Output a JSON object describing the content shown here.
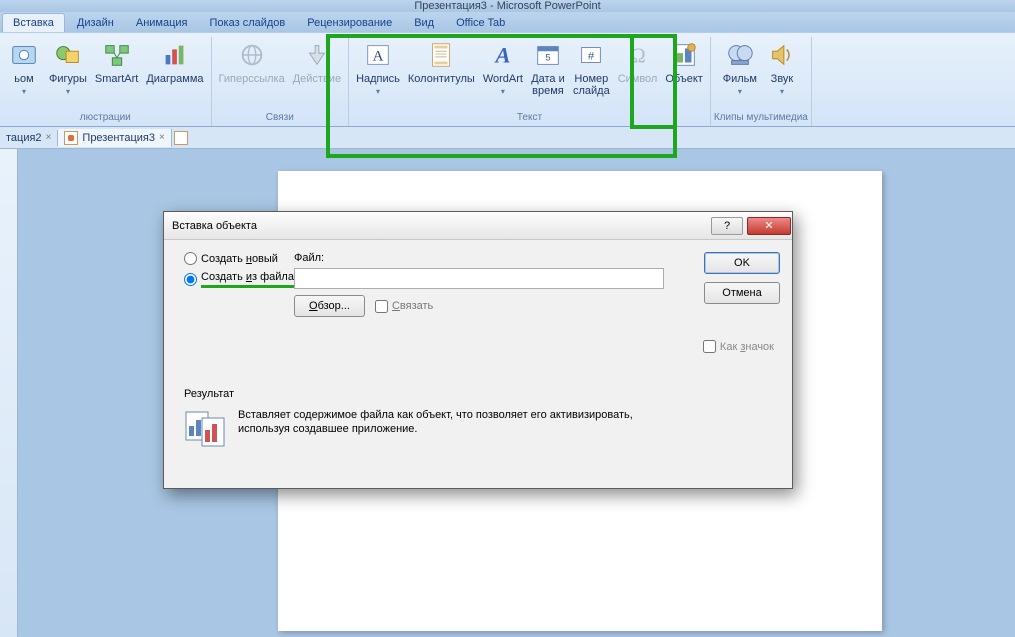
{
  "app_title": "Презентация3 - Microsoft PowerPoint",
  "tabs": {
    "insert": "Вставка",
    "design": "Дизайн",
    "animation": "Анимация",
    "slideshow": "Показ слайдов",
    "review": "Рецензирование",
    "view": "Вид",
    "officetab": "Office Tab"
  },
  "ribbon": {
    "groups": {
      "illustrations": "люстрации",
      "links": "Связи",
      "text": "Текст",
      "media": "Клипы мультимедиа"
    },
    "btns": {
      "album": "ьом",
      "shapes": "Фигуры",
      "smartart": "SmartArt",
      "chart": "Диаграмма",
      "hyperlink": "Гиперссылка",
      "action": "Действие",
      "textbox": "Надпись",
      "headerfooter": "Колонтитулы",
      "wordart": "WordArt",
      "datetime1": "Дата и",
      "datetime2": "время",
      "slidenum1": "Номер",
      "slidenum2": "слайда",
      "symbol": "Символ",
      "object": "Объект",
      "movie": "Фильм",
      "sound": "Звук"
    }
  },
  "doctabs": {
    "tab1": "тация2",
    "tab2": "Презентация3"
  },
  "dialog": {
    "title": "Вставка объекта",
    "create_new": "Создать новый",
    "create_from_file": "Создать из файла",
    "file_label": "Файл:",
    "browse": "Обзор...",
    "link": "Связать",
    "ok": "OK",
    "cancel": "Отмена",
    "as_icon": "Как значок",
    "result_label": "Результат",
    "result_text": "Вставляет содержимое файла как объект, что позволяет его активизировать, используя создавшее приложение.",
    "help_glyph": "?",
    "close_glyph": "✕"
  }
}
